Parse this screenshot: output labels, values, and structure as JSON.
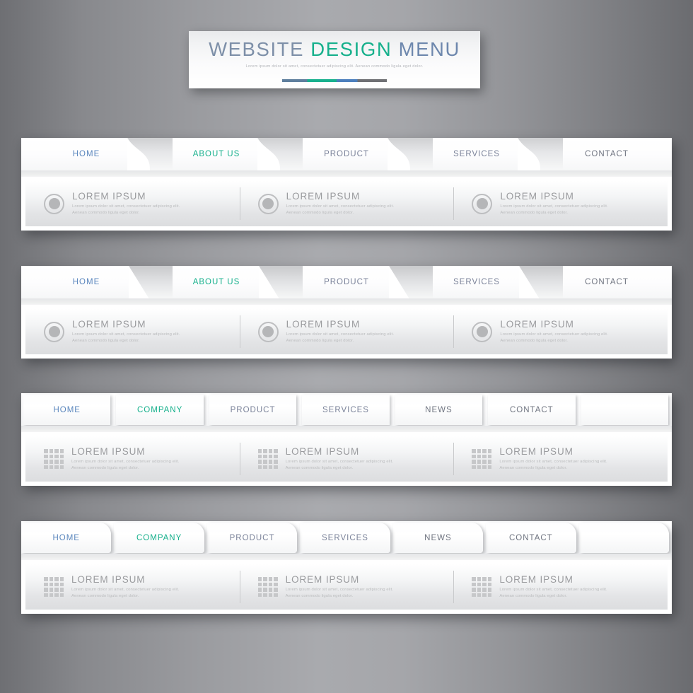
{
  "header": {
    "title_parts": [
      {
        "text": "WEBSITE ",
        "color": "#7d8fa8"
      },
      {
        "text": "DESIGN ",
        "color": "#16b08c"
      },
      {
        "text": "MENU",
        "color": "#6d87ad"
      }
    ],
    "title_full": "WEBSITE DESIGN MENU",
    "subtitle": "Lorem ipsum dolor sit amet, consectetuer adipiscing elit. Aenean commodo ligula eget dolor.",
    "accent_colors": [
      "#5f7f9e",
      "#18b08e",
      "#4c7fbd",
      "#6f7074"
    ]
  },
  "colors": {
    "blue": "#5a86bd",
    "teal": "#16b08c",
    "slate": "#7a8299",
    "gray": "#6f7480",
    "background_light": "#a9aaae",
    "background_dark": "#6e6f73"
  },
  "content_item": {
    "title": "LOREM IPSUM",
    "line1": "Lorem ipsum dolor sit amet, consectetuer adipiscing elit.",
    "line2": "Aenean commodo ligula eget dolor."
  },
  "bars": [
    {
      "id": "bar-curved",
      "style": "curved",
      "icon": "circle-icon",
      "tabs": [
        {
          "label": "HOME",
          "color": "blue"
        },
        {
          "label": "ABOUT US",
          "color": "teal"
        },
        {
          "label": "PRODUCT",
          "color": "slate"
        },
        {
          "label": "SERVICES",
          "color": "slate"
        },
        {
          "label": "CONTACT",
          "color": "gray"
        }
      ],
      "columns": [
        {
          "title": "LOREM IPSUM",
          "line1": "Lorem ipsum dolor sit amet, consectetuer adipiscing elit.",
          "line2": "Aenean commodo ligula eget dolor."
        },
        {
          "title": "LOREM IPSUM",
          "line1": "Lorem ipsum dolor sit amet, consectetuer adipiscing elit.",
          "line2": "Aenean commodo ligula eget dolor."
        },
        {
          "title": "LOREM IPSUM",
          "line1": "Lorem ipsum dolor sit amet, consectetuer adipiscing elit.",
          "line2": "Aenean commodo ligula eget dolor."
        }
      ]
    },
    {
      "id": "bar-diagonal",
      "style": "diagonal",
      "icon": "circle-icon",
      "tabs": [
        {
          "label": "HOME",
          "color": "blue"
        },
        {
          "label": "ABOUT US",
          "color": "teal"
        },
        {
          "label": "PRODUCT",
          "color": "slate"
        },
        {
          "label": "SERVICES",
          "color": "slate"
        },
        {
          "label": "CONTACT",
          "color": "gray"
        }
      ],
      "columns": [
        {
          "title": "LOREM IPSUM",
          "line1": "Lorem ipsum dolor sit amet, consectetuer adipiscing elit.",
          "line2": "Aenean commodo ligula eget dolor."
        },
        {
          "title": "LOREM IPSUM",
          "line1": "Lorem ipsum dolor sit amet, consectetuer adipiscing elit.",
          "line2": "Aenean commodo ligula eget dolor."
        },
        {
          "title": "LOREM IPSUM",
          "line1": "Lorem ipsum dolor sit amet, consectetuer adipiscing elit.",
          "line2": "Aenean commodo ligula eget dolor."
        }
      ]
    },
    {
      "id": "bar-rect",
      "style": "rect",
      "icon": "grid-icon",
      "tabs": [
        {
          "label": "HOME",
          "color": "blue"
        },
        {
          "label": "COMPANY",
          "color": "teal"
        },
        {
          "label": "PRODUCT",
          "color": "slate"
        },
        {
          "label": "SERVICES",
          "color": "slate"
        },
        {
          "label": "NEWS",
          "color": "gray"
        },
        {
          "label": "CONTACT",
          "color": "gray"
        }
      ],
      "columns": [
        {
          "title": "LOREM IPSUM",
          "line1": "Lorem ipsum dolor sit amet, consectetuer adipiscing elit.",
          "line2": "Aenean commodo ligula eget dolor."
        },
        {
          "title": "LOREM IPSUM",
          "line1": "Lorem ipsum dolor sit amet, consectetuer adipiscing elit.",
          "line2": "Aenean commodo ligula eget dolor."
        },
        {
          "title": "LOREM IPSUM",
          "line1": "Lorem ipsum dolor sit amet, consectetuer adipiscing elit.",
          "line2": "Aenean commodo ligula eget dolor."
        }
      ]
    },
    {
      "id": "bar-rounded",
      "style": "rounded",
      "icon": "grid-icon",
      "tabs": [
        {
          "label": "HOME",
          "color": "blue"
        },
        {
          "label": "COMPANY",
          "color": "teal"
        },
        {
          "label": "PRODUCT",
          "color": "slate"
        },
        {
          "label": "SERVICES",
          "color": "slate"
        },
        {
          "label": "NEWS",
          "color": "gray"
        },
        {
          "label": "CONTACT",
          "color": "gray"
        }
      ],
      "columns": [
        {
          "title": "LOREM IPSUM",
          "line1": "Lorem ipsum dolor sit amet, consectetuer adipiscing elit.",
          "line2": "Aenean commodo ligula eget dolor."
        },
        {
          "title": "LOREM IPSUM",
          "line1": "Lorem ipsum dolor sit amet, consectetuer adipiscing elit.",
          "line2": "Aenean commodo ligula eget dolor."
        },
        {
          "title": "LOREM IPSUM",
          "line1": "Lorem ipsum dolor sit amet, consectetuer adipiscing elit.",
          "line2": "Aenean commodo ligula eget dolor."
        }
      ]
    }
  ]
}
